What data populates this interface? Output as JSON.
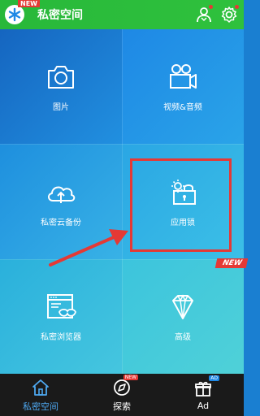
{
  "header": {
    "title": "私密空间",
    "new_badge": "NEW",
    "icons": [
      "snowflake-logo-icon",
      "user-add-icon",
      "gear-icon"
    ]
  },
  "tiles": [
    {
      "label": "图片",
      "icon": "camera-icon"
    },
    {
      "label": "视频&音频",
      "icon": "video-camera-icon"
    },
    {
      "label": "私密云备份",
      "icon": "cloud-upload-icon"
    },
    {
      "label": "应用锁",
      "icon": "lock-icon"
    },
    {
      "label": "私密浏览器",
      "icon": "incognito-browser-icon"
    },
    {
      "label": "高级",
      "icon": "diamond-icon"
    }
  ],
  "new_tile_badge": "NEW",
  "bottom_nav": [
    {
      "label": "私密空间",
      "icon": "home-icon",
      "active": true
    },
    {
      "label": "探索",
      "icon": "explore-icon",
      "badge": "NEW"
    },
    {
      "label": "Ad",
      "icon": "gift-icon",
      "badge": "AD"
    }
  ],
  "colors": {
    "header_green": "#2fc13d",
    "highlight_red": "#e53935",
    "active_blue": "#4ea8f0"
  }
}
